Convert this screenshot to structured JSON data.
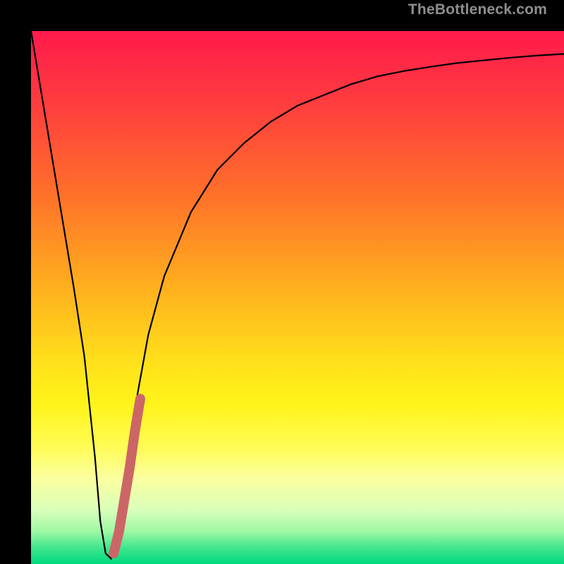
{
  "watermark": "TheBottleneck.com",
  "chart_data": {
    "type": "line",
    "title": "",
    "xlabel": "",
    "ylabel": "",
    "xlim": [
      0,
      100
    ],
    "ylim": [
      0,
      100
    ],
    "background_gradient": {
      "stops": [
        {
          "offset": 0.0,
          "color": "#ff1a4b"
        },
        {
          "offset": 0.14,
          "color": "#ff3e3e"
        },
        {
          "offset": 0.3,
          "color": "#ff6e2a"
        },
        {
          "offset": 0.46,
          "color": "#ffa81f"
        },
        {
          "offset": 0.62,
          "color": "#ffe01a"
        },
        {
          "offset": 0.7,
          "color": "#fff41a"
        },
        {
          "offset": 0.78,
          "color": "#fffc55"
        },
        {
          "offset": 0.84,
          "color": "#fbffa0"
        },
        {
          "offset": 0.9,
          "color": "#d8ffba"
        },
        {
          "offset": 0.94,
          "color": "#9cf7a4"
        },
        {
          "offset": 0.97,
          "color": "#3fe58c"
        },
        {
          "offset": 1.0,
          "color": "#00d97e"
        }
      ]
    },
    "series": [
      {
        "name": "bottleneck-curve",
        "color": "#000000",
        "width": 2.2,
        "x": [
          0,
          2,
          4,
          6,
          8,
          10,
          12,
          13,
          14,
          15,
          16,
          18,
          20,
          22,
          25,
          30,
          35,
          40,
          45,
          50,
          55,
          60,
          65,
          70,
          75,
          80,
          85,
          90,
          95,
          100
        ],
        "values": [
          100,
          88,
          76,
          64,
          52,
          39,
          20,
          8,
          2,
          1,
          4,
          18,
          32,
          43,
          54,
          66,
          74,
          79,
          83,
          86,
          88,
          90,
          91.5,
          92.5,
          93.3,
          94,
          94.5,
          95,
          95.4,
          95.7
        ]
      },
      {
        "name": "highlight-segment",
        "color": "#cc6666",
        "width": 14,
        "linecap": "round",
        "x": [
          15.5,
          16.5,
          17.5,
          18.5,
          19.5,
          20.5
        ],
        "values": [
          2,
          6,
          12,
          18,
          25,
          31
        ]
      }
    ]
  }
}
